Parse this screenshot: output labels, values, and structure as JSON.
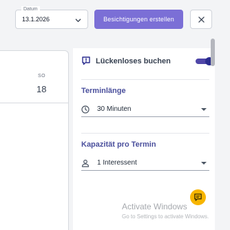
{
  "toolbar": {
    "date_label": "Datum",
    "date_value": "13.1.2026",
    "primary_button": "Besichtigungen erstellen",
    "close_icon": "close-icon"
  },
  "calendar": {
    "day_name": "SO",
    "day_number": "18"
  },
  "settings": {
    "gapless_booking": {
      "label": "Lückenloses buchen",
      "icon": "warning-chat-icon",
      "enabled": true
    },
    "appointment_length": {
      "title": "Terminlänge",
      "icon": "clock-icon",
      "value": "30 Minuten"
    },
    "capacity": {
      "title": "Kapazität pro Termin",
      "icon": "person-icon",
      "value": "1 Interessent"
    }
  },
  "chat_fab": {
    "icon": "chat-icon"
  },
  "watermark": {
    "title": "Activate Windows",
    "subtitle": "Go to Settings to activate Windows."
  },
  "colors": {
    "primary": "#7b6fd6",
    "toggle_on": "#2b2d8f",
    "section_title": "#4a4f9c",
    "fab": "#f7b500"
  }
}
